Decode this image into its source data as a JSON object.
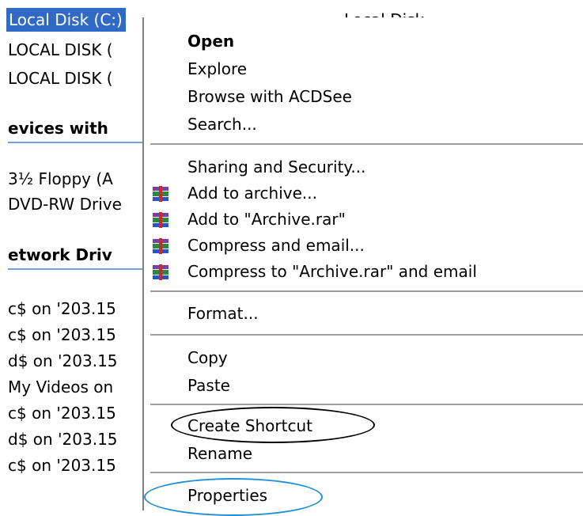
{
  "drive_list": {
    "selected_drive": "Local Disk (C:)",
    "selected_type": "Local Disk",
    "local_rows": [
      "LOCAL DISK (",
      "LOCAL DISK ("
    ],
    "group_removable": "evices with",
    "removable_rows": [
      "3½ Floppy (A",
      "DVD-RW Drive"
    ],
    "group_network": "etwork Driv",
    "network_rows": [
      "c$ on '203.15",
      "c$ on '203.15",
      "d$ on '203.15",
      "My Videos on",
      "c$ on '203.15",
      "d$ on '203.15",
      "c$ on '203.15"
    ]
  },
  "context_menu": {
    "open": "Open",
    "explore": "Explore",
    "browse_acdsee": "Browse with ACDSee",
    "search": "Search...",
    "sharing": "Sharing and Security...",
    "add_archive": "Add to archive...",
    "add_rar": "Add to \"Archive.rar\"",
    "compress_email": "Compress and email...",
    "compress_rar_email": "Compress to \"Archive.rar\" and email",
    "format": "Format...",
    "copy": "Copy",
    "paste": "Paste",
    "create_shortcut": "Create Shortcut",
    "rename": "Rename",
    "properties": "Properties"
  },
  "colors": {
    "selection": "#316ac5",
    "highlight_oval_black": "#000000",
    "highlight_oval_blue": "#1f8fd6"
  }
}
